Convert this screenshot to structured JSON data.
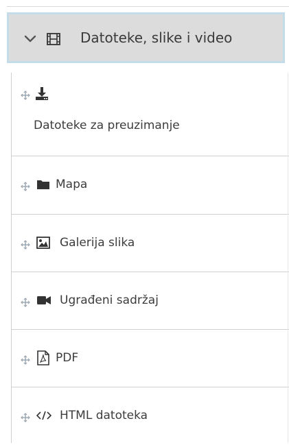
{
  "group": {
    "title": "Datoteke, slike i video",
    "icon": "film-icon",
    "expanded": true,
    "border_color": "#c4dcea",
    "background": "#dcdcdc"
  },
  "items": [
    {
      "label": "Datoteke za preuzimanje",
      "icon": "download-icon"
    },
    {
      "label": "Mapa",
      "icon": "folder-icon"
    },
    {
      "label": "Galerija slika",
      "icon": "image-icon"
    },
    {
      "label": "Ugrađeni sadržaj",
      "icon": "video-camera-icon"
    },
    {
      "label": "PDF",
      "icon": "pdf-icon"
    },
    {
      "label": "HTML datoteka",
      "icon": "code-icon"
    }
  ]
}
